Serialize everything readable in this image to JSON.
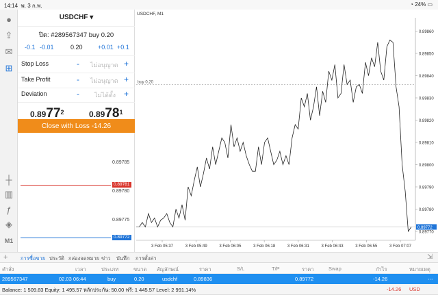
{
  "status_bar": {
    "time": "14:14",
    "date": "พ. 3 ก.พ.",
    "battery": "24%"
  },
  "order_panel": {
    "symbol": "USDCHF",
    "position_label": "ปิด: #289567347 buy 0.20",
    "volume_steps": [
      "-0.1",
      "-0.01",
      "0.20",
      "+0.01",
      "+0.1"
    ],
    "stop_loss": {
      "label": "Stop Loss",
      "value": "ไม่อนุญาต",
      "minus": "-",
      "plus": "+"
    },
    "take_profit": {
      "label": "Take Profit",
      "value": "ไม่อนุญาต",
      "minus": "-",
      "plus": "+"
    },
    "deviation": {
      "label": "Deviation",
      "value": "ไม่ได้ตั้ง",
      "minus": "-",
      "plus": "+"
    },
    "bid": {
      "prefix": "0.89",
      "big": "77",
      "sup": "2"
    },
    "ask": {
      "prefix": "0.89",
      "big": "78",
      "sup": "1"
    },
    "close_button": "Close with Loss -14.26"
  },
  "dom": {
    "levels": [
      "0.89785",
      "0.89780",
      "0.89775"
    ],
    "ask_tag": "0.89781",
    "bid_tag": "0.89772",
    "ask_color": "#d9342b",
    "bid_color": "#1f74d8"
  },
  "chart_data": {
    "type": "line",
    "title": "USDCHF, M1",
    "x_ticks": [
      "3 Feb 05:37",
      "3 Feb 05:49",
      "3 Feb 06:05",
      "3 Feb 06:18",
      "3 Feb 06:31",
      "3 Feb 06:43",
      "3 Feb 06:55",
      "3 Feb 07:07"
    ],
    "y_ticks": [
      "0.89860",
      "0.89850",
      "0.89840",
      "0.89830",
      "0.89820",
      "0.89810",
      "0.89800",
      "0.89790",
      "0.89780",
      "0.89770"
    ],
    "ylim": [
      0.89766,
      0.89866
    ],
    "buy_line": {
      "label": "buy 0.20",
      "value": 0.89836
    },
    "current_price": {
      "label": "0.89772",
      "value": 0.89772
    },
    "values": [
      0.89772,
      0.89772,
      0.89774,
      0.89772,
      0.89778,
      0.89774,
      0.89776,
      0.89772,
      0.89775,
      0.89776,
      0.89778,
      0.89774,
      0.89772,
      0.8978,
      0.89776,
      0.89782,
      0.89775,
      0.8979,
      0.89786,
      0.89793,
      0.89799,
      0.8979,
      0.89796,
      0.89803,
      0.89798,
      0.89808,
      0.898,
      0.89806,
      0.89812,
      0.8981,
      0.89803,
      0.89818,
      0.89808,
      0.89812,
      0.89806,
      0.8981,
      0.89804,
      0.898,
      0.89797,
      0.89797,
      0.89808,
      0.898,
      0.8981,
      0.89812,
      0.89806,
      0.898,
      0.89802,
      0.89806,
      0.898,
      0.89804,
      0.898,
      0.89812,
      0.89818,
      0.89816,
      0.8983,
      0.89826,
      0.89832,
      0.8982,
      0.89826,
      0.89835,
      0.89822,
      0.89833,
      0.89828,
      0.89842,
      0.89838,
      0.89845,
      0.8983,
      0.89832,
      0.89845,
      0.89836,
      0.89838,
      0.89828,
      0.89835,
      0.89836,
      0.89832,
      0.89846,
      0.8984,
      0.89848,
      0.89844,
      0.89855,
      0.89842,
      0.89838,
      0.89853,
      0.89856,
      0.89855,
      0.89835,
      0.89826,
      0.898,
      0.89788,
      0.8977,
      0.89772
    ]
  },
  "tabs": [
    "การซื้อขาย",
    "ประวัติ",
    "กล่องจดหมาย",
    "ข่าว",
    "บันทึก",
    "การตั้งค่า"
  ],
  "table": {
    "headers": [
      "คำสั่ง",
      "เวลา",
      "ประเภท",
      "ขนาด",
      "สัญลักษณ์",
      "ราคา",
      "S/L",
      "T/P",
      "ราคา",
      "Swap",
      "กำไร",
      "หมายเหตุ"
    ],
    "row": [
      "289567347",
      "02.03 06:44",
      "buy",
      "0.20",
      "usdchf",
      "0.89836",
      "",
      "",
      "0.89772",
      "",
      "-14.26",
      ""
    ]
  },
  "balance": {
    "text": "Balance: 1 509.83 Equity: 1 495.57 หลักประกัน: 50.00 ฟรี: 1 445.57 Level: 2 991.14%",
    "profit": "-14.26",
    "currency": "USD"
  },
  "colors": {
    "accent": "#1f74d8",
    "close_button": "#f08c1a",
    "selected_row": "#1f8ff0",
    "loss": "#d9342b"
  }
}
